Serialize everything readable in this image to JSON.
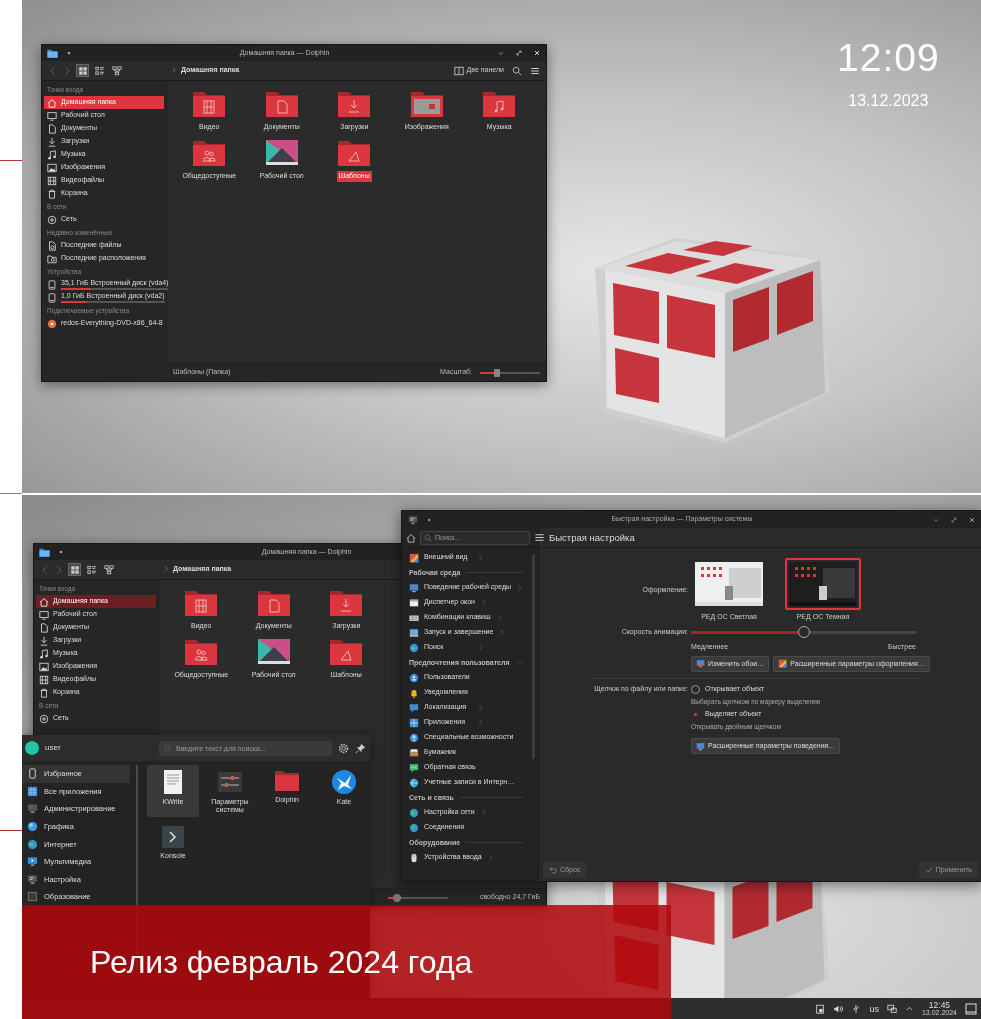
{
  "top_screen": {
    "clock": {
      "time": "12:09",
      "date": "13.12.2023"
    },
    "dolphin": {
      "title": "Домашняя папка — Dolphin",
      "view_modes": [
        {
          "kind": "icons",
          "selected": true
        },
        {
          "kind": "details",
          "selected": false
        },
        {
          "kind": "compact",
          "selected": false
        }
      ],
      "breadcrumb": "Домашняя папка",
      "split_button": "Две панели",
      "sidebar": [
        {
          "heading": "Точки входа",
          "items": [
            {
              "label": "Домашняя папка",
              "kind": "home",
              "selected": true
            },
            {
              "label": "Рабочий стол",
              "kind": "desktop",
              "selected": false
            },
            {
              "label": "Документы",
              "kind": "documents",
              "selected": false
            },
            {
              "label": "Загрузки",
              "kind": "downloads",
              "selected": false
            },
            {
              "label": "Музыка",
              "kind": "music",
              "selected": false
            },
            {
              "label": "Изображения",
              "kind": "pictures",
              "selected": false
            },
            {
              "label": "Видеофайлы",
              "kind": "videos",
              "selected": false
            },
            {
              "label": "Корзина",
              "kind": "trash",
              "selected": false
            }
          ]
        },
        {
          "heading": "В сети",
          "items": [
            {
              "label": "Сеть",
              "kind": "network",
              "selected": false
            }
          ]
        },
        {
          "heading": "Недавно изменённые",
          "items": [
            {
              "label": "Последние файлы",
              "kind": "recent-files",
              "selected": false
            },
            {
              "label": "Последние расположения",
              "kind": "recent-locations",
              "selected": false
            }
          ]
        },
        {
          "heading": "Устройства",
          "items": [
            {
              "label": "35,1 ГиБ Встроенный диск (vda4)",
              "kind": "disk",
              "selected": false,
              "level": 0.28
            },
            {
              "label": "1,0 ГиБ Встроенный диск (vda2)",
              "kind": "disk",
              "selected": false,
              "level": 0.25
            }
          ]
        },
        {
          "heading": "Подключаемые устройства",
          "items": [
            {
              "label": "redos-Everything-DVD-x86_64-8",
              "kind": "dvd",
              "selected": false
            }
          ]
        }
      ],
      "files": [
        {
          "name": "Видео",
          "kind": "video",
          "selected": false
        },
        {
          "name": "Документы",
          "kind": "documents",
          "selected": false
        },
        {
          "name": "Загрузки",
          "kind": "downloads",
          "selected": false
        },
        {
          "name": "Изображения",
          "kind": "pictures",
          "selected": false
        },
        {
          "name": "Музыка",
          "kind": "music",
          "selected": false
        },
        {
          "name": "Общедоступные",
          "kind": "public",
          "selected": false
        },
        {
          "name": "Рабочий стол",
          "kind": "desktop",
          "selected": false
        },
        {
          "name": "Шаблоны",
          "kind": "templates",
          "selected": true
        }
      ],
      "status": "Шаблоны (Папка)",
      "zoom_label": "Масштаб:",
      "zoom": {
        "level": 0.28
      }
    }
  },
  "bottom_screen": {
    "dolphin": {
      "title": "Домашняя папка — Dolphin",
      "view_modes": [
        {
          "kind": "icons",
          "selected": true
        },
        {
          "kind": "details",
          "selected": false
        },
        {
          "kind": "compact",
          "selected": false
        }
      ],
      "breadcrumb": "Домашняя папка",
      "sidebar": [
        {
          "heading": "Точки входа",
          "items": [
            {
              "label": "Домашняя папка",
              "kind": "home",
              "selected": true
            },
            {
              "label": "Рабочий стол",
              "kind": "desktop",
              "selected": false
            },
            {
              "label": "Документы",
              "kind": "documents",
              "selected": false
            },
            {
              "label": "Загрузки",
              "kind": "downloads",
              "selected": false
            },
            {
              "label": "Музыка",
              "kind": "music",
              "selected": false
            },
            {
              "label": "Изображения",
              "kind": "pictures",
              "selected": false
            },
            {
              "label": "Видеофайлы",
              "kind": "videos",
              "selected": false
            },
            {
              "label": "Корзина",
              "kind": "trash",
              "selected": false
            }
          ]
        },
        {
          "heading": "В сети",
          "items": [
            {
              "label": "Сеть",
              "kind": "network",
              "selected": false
            }
          ]
        }
      ],
      "files": [
        {
          "name": "Видео",
          "kind": "video",
          "selected": false
        },
        {
          "name": "Документы",
          "kind": "documents",
          "selected": false
        },
        {
          "name": "Загрузки",
          "kind": "downloads",
          "selected": false
        },
        {
          "name": "Общедоступные",
          "kind": "public",
          "selected": false
        },
        {
          "name": "Рабочий стол",
          "kind": "desktop",
          "selected": false
        },
        {
          "name": "Шаблоны",
          "kind": "templates",
          "selected": false
        }
      ],
      "zoom": {
        "level": 0.15
      },
      "free_space": "свободно 24,7 ГиБ"
    },
    "settings": {
      "title": "Быстрая настройка — Параметры системы",
      "search": {
        "placeholder": "Поиск..."
      },
      "page_title": "Быстрая настройка",
      "nav": [
        {
          "items": [
            {
              "label": "Внешний вид",
              "kind": "appearance",
              "expandable": true
            }
          ]
        },
        {
          "heading": "Рабочая среда",
          "items": [
            {
              "label": "Поведение рабочей среды",
              "kind": "workspace",
              "expandable": true
            },
            {
              "label": "Диспетчер окон",
              "kind": "windows",
              "expandable": true
            },
            {
              "label": "Комбинации клавиш",
              "kind": "keyboard",
              "expandable": true
            },
            {
              "label": "Запуск и завершение",
              "kind": "startup",
              "expandable": true
            },
            {
              "label": "Поиск",
              "kind": "search-settings",
              "expandable": true
            }
          ]
        },
        {
          "heading": "Предпочтения пользователя",
          "items": [
            {
              "label": "Пользователи",
              "kind": "users",
              "expandable": false
            },
            {
              "label": "Уведомления",
              "kind": "notifications",
              "expandable": false
            },
            {
              "label": "Локализация",
              "kind": "locale",
              "expandable": true
            },
            {
              "label": "Приложения",
              "kind": "applications",
              "expandable": true
            },
            {
              "label": "Специальные возможности",
              "kind": "accessibility",
              "expandable": false
            },
            {
              "label": "Бумажник",
              "kind": "wallet",
              "expandable": false
            },
            {
              "label": "Обратная связь",
              "kind": "feedback",
              "expandable": false
            },
            {
              "label": "Учетные записи в Интерн…",
              "kind": "accounts",
              "expandable": false
            }
          ]
        },
        {
          "heading": "Сеть и связь",
          "items": [
            {
              "label": "Настройка сети",
              "kind": "network-settings",
              "expandable": true
            },
            {
              "label": "Соединения",
              "kind": "connections",
              "expandable": false
            }
          ]
        },
        {
          "heading": "Оборудование",
          "items": [
            {
              "label": "Устройства ввода",
              "kind": "input",
              "expandable": true
            }
          ]
        }
      ],
      "appearance_label": "Оформление:",
      "themes": [
        {
          "name": "РЕД ОС Светлая",
          "kind": "light",
          "selected": false
        },
        {
          "name": "РЕД ОС Темная",
          "kind": "dark",
          "selected": true
        }
      ],
      "animation_label": "Скорость анимации:",
      "animation_speed": {
        "level": 0.5
      },
      "slower": "Медленнее",
      "faster": "Быстрее",
      "buttons": [
        {
          "label": "Изменить обои…",
          "kind": "wallpaper"
        },
        {
          "label": "Расширенные параметры оформления…",
          "kind": "appearance"
        }
      ],
      "click_label": "Щелчок по файлу или папке:",
      "click_options": [
        {
          "label": "Открывает объект",
          "hint": "Выбирать щелчком по маркеру выделения",
          "selected": false
        },
        {
          "label": "Выделяет объект",
          "hint": "Открывать двойным щелчком",
          "selected": true
        }
      ],
      "behavior_button": "Расширенные параметры поведения…",
      "reset_button": {
        "label": "Сброс",
        "disabled": true
      },
      "apply_button": {
        "label": "Применить",
        "disabled": true
      }
    },
    "launcher": {
      "user": "user",
      "search": {
        "placeholder": "Введите текст для поиска..."
      },
      "categories": [
        {
          "label": "Избранное",
          "kind": "favorites",
          "selected": true
        },
        {
          "label": "Все приложения",
          "kind": "all",
          "selected": false
        },
        {
          "label": "Администрирование",
          "kind": "admin",
          "selected": false
        },
        {
          "label": "Графика",
          "kind": "graphics",
          "selected": false
        },
        {
          "label": "Интернет",
          "kind": "internet",
          "selected": false
        },
        {
          "label": "Мультимедиа",
          "kind": "multimedia",
          "selected": false
        },
        {
          "label": "Настройка",
          "kind": "setup",
          "selected": false
        },
        {
          "label": "Образование",
          "kind": "education",
          "selected": false
        }
      ],
      "apps": [
        {
          "name": "KWrite",
          "kind": "kwrite",
          "selected": true
        },
        {
          "name": "Параметры системы",
          "kind": "system-settings",
          "selected": false
        },
        {
          "name": "Dolphin",
          "kind": "dolphin",
          "selected": false
        },
        {
          "name": "Kate",
          "kind": "kate",
          "selected": false
        },
        {
          "name": "Konsole",
          "kind": "konsole",
          "selected": false
        }
      ]
    },
    "taskbar": {
      "keyboard_layout": "us",
      "time": "12:45",
      "date": "13.02.2024"
    }
  },
  "banner": {
    "text": "Релиз февраль 2024 года"
  }
}
